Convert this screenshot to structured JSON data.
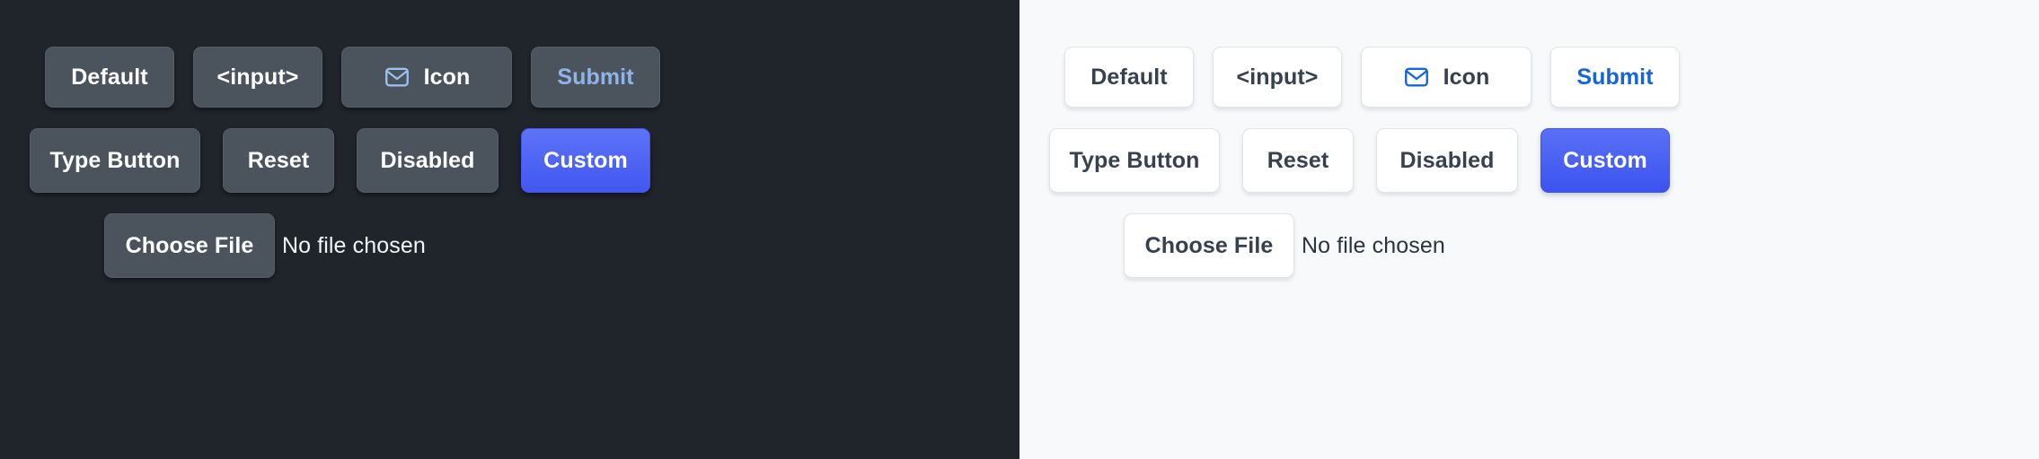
{
  "panels": [
    {
      "theme": "dark",
      "background": "#20242b",
      "button_bg": "#4b535d",
      "text_color": "#ffffff",
      "submit_color": "#8fb4e8",
      "custom_color": "#4257f0",
      "icon_color": "#9cc0ec",
      "rows": [
        {
          "buttons": [
            {
              "label": "Default",
              "name": "default-button"
            },
            {
              "label": "<input>",
              "name": "input-button"
            },
            {
              "label": "Icon",
              "name": "icon-button",
              "icon": "envelope-icon"
            },
            {
              "label": "Submit",
              "name": "submit-button"
            }
          ]
        },
        {
          "buttons": [
            {
              "label": "Type Button",
              "name": "type-button"
            },
            {
              "label": "Reset",
              "name": "reset-button"
            },
            {
              "label": "Disabled",
              "name": "disabled-button"
            },
            {
              "label": "Custom",
              "name": "custom-button"
            }
          ]
        },
        {
          "file_button_label": "Choose File",
          "file_status": "No file chosen"
        }
      ]
    },
    {
      "theme": "light",
      "background": "#f7f9fb",
      "button_bg": "#ffffff",
      "button_border": "#dfe4e9",
      "text_color": "#37414d",
      "submit_color": "#1565d8",
      "custom_color": "#3c53ef",
      "icon_color": "#1565d8",
      "rows": [
        {
          "buttons": [
            {
              "label": "Default",
              "name": "default-button"
            },
            {
              "label": "<input>",
              "name": "input-button"
            },
            {
              "label": "Icon",
              "name": "icon-button",
              "icon": "envelope-icon"
            },
            {
              "label": "Submit",
              "name": "submit-button"
            }
          ]
        },
        {
          "buttons": [
            {
              "label": "Type Button",
              "name": "type-button"
            },
            {
              "label": "Reset",
              "name": "reset-button"
            },
            {
              "label": "Disabled",
              "name": "disabled-button"
            },
            {
              "label": "Custom",
              "name": "custom-button"
            }
          ]
        },
        {
          "file_button_label": "Choose File",
          "file_status": "No file chosen"
        }
      ]
    }
  ]
}
